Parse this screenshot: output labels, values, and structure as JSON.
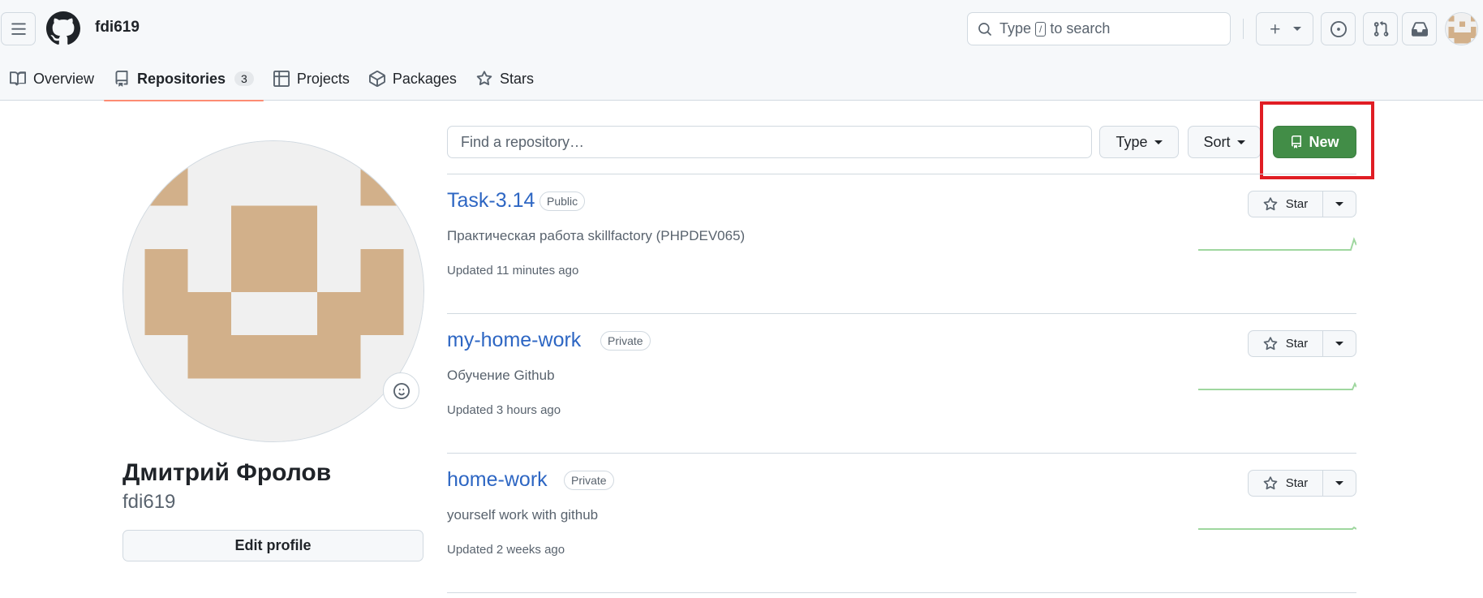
{
  "header": {
    "username": "fdi619",
    "search_prefix": "Type",
    "search_key": "/",
    "search_suffix": "to search"
  },
  "tabs": [
    {
      "label": "Overview"
    },
    {
      "label": "Repositories",
      "count": "3"
    },
    {
      "label": "Projects"
    },
    {
      "label": "Packages"
    },
    {
      "label": "Stars"
    }
  ],
  "profile": {
    "full_name": "Дмитрий Фролов",
    "login": "fdi619",
    "edit_label": "Edit profile"
  },
  "toolbar": {
    "find_placeholder": "Find a repository…",
    "type_label": "Type",
    "sort_label": "Sort",
    "new_label": "New"
  },
  "repos": [
    {
      "name": "Task-3.14",
      "visibility": "Public",
      "description": "Практическая работа skillfactory (PHPDEV065)",
      "updated": "Updated 11 minutes ago",
      "star_label": "Star"
    },
    {
      "name": "my-home-work",
      "visibility": "Private",
      "description": "Обучение Github",
      "updated": "Updated 3 hours ago",
      "star_label": "Star"
    },
    {
      "name": "home-work",
      "visibility": "Private",
      "description": "yourself work with github",
      "updated": "Updated 2 weeks ago",
      "star_label": "Star"
    }
  ],
  "colors": {
    "accent_link": "#2d66c3",
    "new_button": "#428d47",
    "annotation_box": "#e01d24",
    "avatar_tan": "#d2b08a",
    "tab_underline": "#fd8c73",
    "sparkline": "#9fd79f"
  }
}
